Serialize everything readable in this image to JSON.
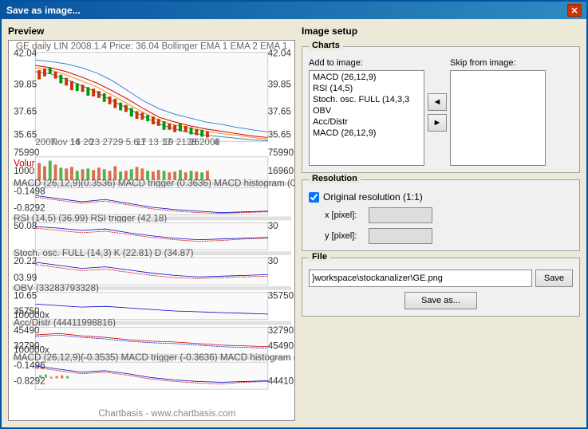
{
  "window": {
    "title": "Save as image...",
    "close_label": "✕"
  },
  "left_panel": {
    "preview_label": "Preview"
  },
  "right_panel": {
    "image_setup_label": "Image setup",
    "charts_section": {
      "title": "Charts",
      "add_to_image_label": "Add to image:",
      "skip_from_image_label": "Skip from image:",
      "add_items": [
        "MACD (26,12,9)",
        "RSI (14,5)",
        "Stoch. osc. FULL (14,3,3)",
        "OBV",
        "Acc/Distr",
        "MACD (26,12,9)"
      ],
      "skip_items": [],
      "left_arrow": "◄",
      "right_arrow": "►"
    },
    "resolution_section": {
      "title": "Resolution",
      "original_resolution_label": "Original resolution (1:1)",
      "x_label": "x [pixel]:",
      "y_label": "y [pixel]:",
      "x_value": "",
      "y_value": "",
      "checked": true
    },
    "file_section": {
      "title": "File",
      "file_path": "}workspace\\stockanalizer\\GE.png",
      "save_label": "Save",
      "save_as_label": "Save as..."
    }
  }
}
